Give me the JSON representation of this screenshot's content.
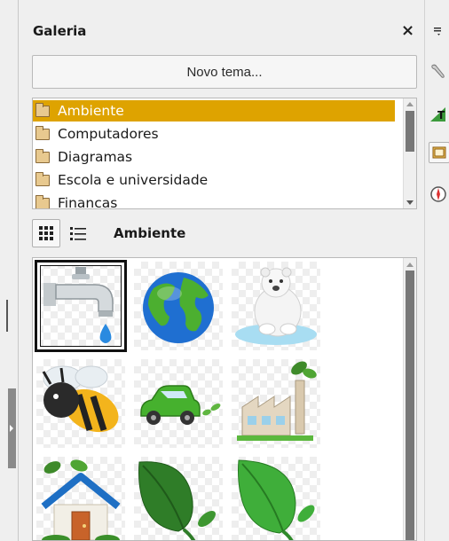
{
  "panel": {
    "title": "Galeria",
    "close_glyph": "×",
    "new_theme_label": "Novo tema..."
  },
  "themes": {
    "items": [
      {
        "label": "Ambiente",
        "selected": true
      },
      {
        "label": "Computadores",
        "selected": false
      },
      {
        "label": "Diagramas",
        "selected": false
      },
      {
        "label": "Escola e universidade",
        "selected": false
      },
      {
        "label": "Financas",
        "selected": false
      }
    ]
  },
  "view": {
    "current_theme": "Ambiente",
    "modes": [
      "icon-view",
      "detailed-view"
    ],
    "active_mode": "icon-view"
  },
  "gallery": {
    "items": [
      "tap-water",
      "globe",
      "polar-bear",
      "bee",
      "eco-car",
      "factory",
      "house-with-plant",
      "leaf-sprout",
      "green-leaf"
    ],
    "selected": "tap-water"
  },
  "sidebar": {
    "buttons": [
      "menu-icon",
      "properties-wrench-icon",
      "styles-icon",
      "gallery-icon",
      "navigator-icon"
    ],
    "active": "gallery-icon"
  },
  "colors": {
    "selection": "#dea300",
    "scroll_thumb": "#777777"
  }
}
